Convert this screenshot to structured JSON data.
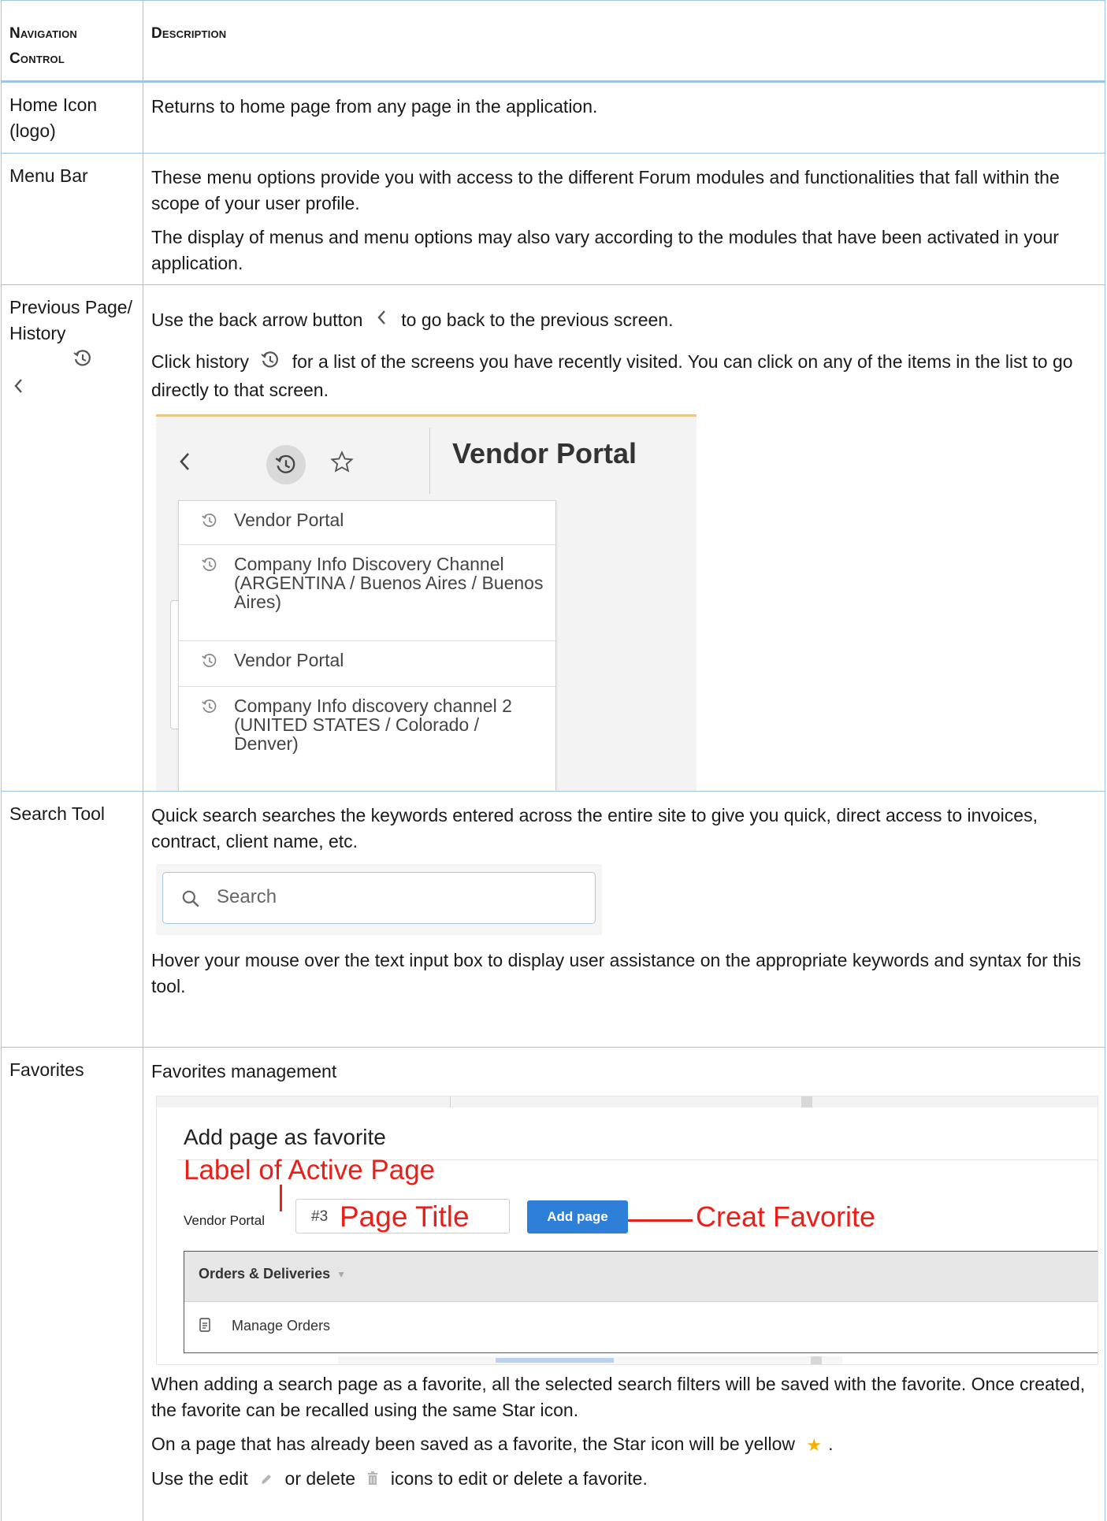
{
  "table": {
    "header": {
      "col1": "Navigation Control",
      "col2": "Description"
    },
    "rows": {
      "home": {
        "control": "Home Icon (logo)",
        "desc": "Returns to home page from any page in the application."
      },
      "menu": {
        "control": "Menu Bar",
        "desc1": "These menu options provide you with access to the different Forum modules and functionalities that fall within the scope of your user profile.",
        "desc2": "The display of menus and menu options may also vary according to the modules that have been activated in your application."
      },
      "history": {
        "control": "Previous Page/History",
        "back_pre": "Use the back arrow button",
        "back_post": "to go back to the previous screen.",
        "hist_pre": "Click history",
        "hist_post": "for a list of the screens you have recently visited. You can click on any of the items in the list to go directly to that screen.",
        "shot": {
          "title": "Vendor Portal",
          "items": [
            "Vendor Portal",
            "Company Info Discovery Channel (ARGENTINA / Buenos Aires / Buenos Aires)",
            "Vendor Portal",
            "Company Info discovery channel 2 (UNITED STATES / Colorado / Denver)"
          ]
        }
      },
      "search": {
        "control": "Search Tool",
        "desc1": "Quick search searches the keywords entered across the entire site to give you quick, direct access to invoices, contract, client name, etc.",
        "placeholder": "Search",
        "desc2": "Hover your mouse over the text input box to display user assistance on the appropriate keywords and syntax for this tool."
      },
      "favorites": {
        "control": "Favorites",
        "desc_title": "Favorites management",
        "shot": {
          "heading": "Add page as favorite",
          "ann_label": "Label of Active Page",
          "ann_title": "Page Title",
          "ann_create": "Creat Favorite",
          "page_label": "Vendor Portal",
          "input_prefix": "#3",
          "button": "Add page",
          "group": "Orders & Deliveries",
          "item": "Manage Orders"
        },
        "desc1": "When adding a search page as a favorite, all the selected search filters will be saved with the favorite. Once created, the favorite can be recalled using the same Star icon.",
        "desc2_pre": "On a page that has already been saved as a favorite, the Star icon will be yellow",
        "desc2_post": ".",
        "desc3_a": "Use the edit",
        "desc3_b": "or delete",
        "desc3_c": "icons to edit or delete a favorite."
      }
    }
  },
  "colors": {
    "border": "#9dc3e6",
    "annotation": "#e8201a",
    "button": "#2e7fd8",
    "star_yellow": "#f5b301"
  },
  "icons": [
    "back-arrow-icon",
    "history-icon",
    "star-outline-icon",
    "search-icon",
    "document-icon",
    "star-yellow-icon",
    "pencil-icon",
    "trash-icon"
  ]
}
